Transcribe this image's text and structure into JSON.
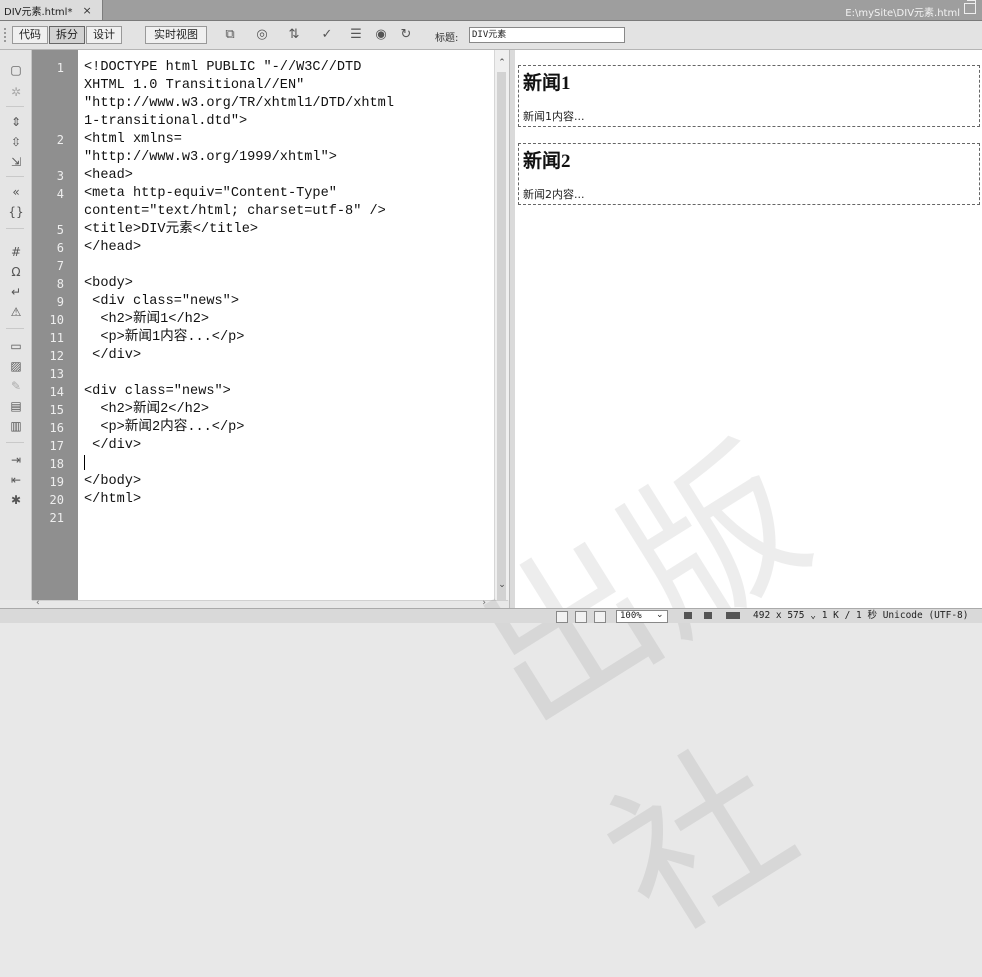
{
  "document_tab": {
    "name": "DIV元素.html*",
    "close": "×"
  },
  "file_path": "E:\\mySite\\DIV元素.html",
  "toolbar": {
    "views": [
      "代码",
      "拆分",
      "设计",
      "实时视图"
    ],
    "active_view": "拆分",
    "title_label": "标题:",
    "title_value": "DIV元素"
  },
  "code_lines": [
    {
      "number": "1",
      "rows": [
        "<!DOCTYPE html PUBLIC \"-//W3C//DTD",
        "XHTML 1.0 Transitional//EN\"",
        "\"http://www.w3.org/TR/xhtml1/DTD/xhtml",
        "1-transitional.dtd\">"
      ]
    },
    {
      "number": "2",
      "rows": [
        "<html xmlns=",
        "\"http://www.w3.org/1999/xhtml\">"
      ]
    },
    {
      "number": "3",
      "rows": [
        "<head>"
      ]
    },
    {
      "number": "4",
      "rows": [
        "<meta http-equiv=\"Content-Type\"",
        "content=\"text/html; charset=utf-8\" />"
      ]
    },
    {
      "number": "5",
      "rows": [
        "<title>DIV元素</title>"
      ]
    },
    {
      "number": "6",
      "rows": [
        "</head>"
      ]
    },
    {
      "number": "7",
      "rows": [
        ""
      ]
    },
    {
      "number": "8",
      "rows": [
        "<body>"
      ]
    },
    {
      "number": "9",
      "rows": [
        " <div class=\"news\">"
      ]
    },
    {
      "number": "10",
      "rows": [
        "  <h2>新闻1</h2>"
      ]
    },
    {
      "number": "11",
      "rows": [
        "  <p>新闻1内容...</p>"
      ]
    },
    {
      "number": "12",
      "rows": [
        " </div>"
      ]
    },
    {
      "number": "13",
      "rows": [
        ""
      ]
    },
    {
      "number": "14",
      "rows": [
        "<div class=\"news\">"
      ]
    },
    {
      "number": "15",
      "rows": [
        "  <h2>新闻2</h2>"
      ]
    },
    {
      "number": "16",
      "rows": [
        "  <p>新闻2内容...</p>"
      ]
    },
    {
      "number": "17",
      "rows": [
        " </div>"
      ]
    },
    {
      "number": "18",
      "rows": [
        ""
      ]
    },
    {
      "number": "19",
      "rows": [
        "</body>"
      ]
    },
    {
      "number": "20",
      "rows": [
        "</html>"
      ]
    },
    {
      "number": "21",
      "rows": [
        ""
      ]
    }
  ],
  "design_view": {
    "news": [
      {
        "heading": "新闻1",
        "body": "新闻1内容..."
      },
      {
        "heading": "新闻2",
        "body": "新闻2内容..."
      }
    ]
  },
  "status_bar": {
    "zoom": "100%",
    "window_size": "492 x 575",
    "download": "1 K / 1 秒",
    "encoding": "Unicode (UTF-8)"
  },
  "watermark": "出版社"
}
